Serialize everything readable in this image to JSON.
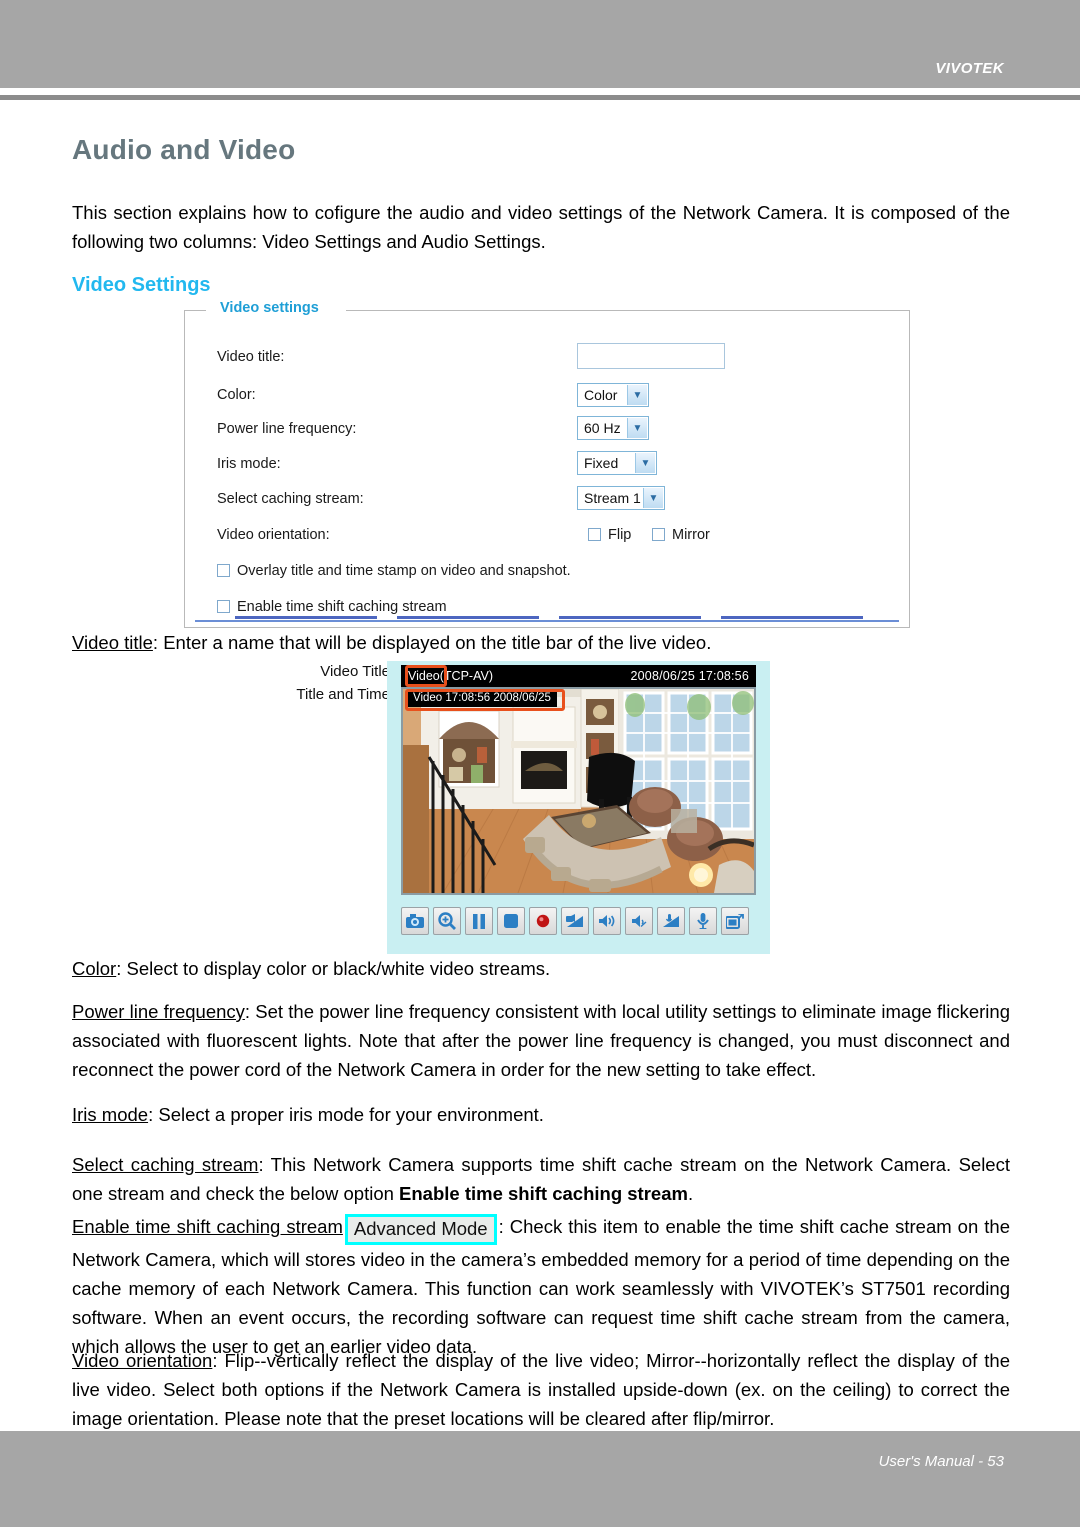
{
  "header": {
    "brand": "VIVOTEK"
  },
  "page": {
    "title": "Audio and Video",
    "intro": "This section explains how to cofigure the audio and video settings of the Network Camera. It is composed of the following two columns: Video Settings and Audio Settings.",
    "section_title": "Video Settings"
  },
  "video_settings_panel": {
    "legend": "Video settings",
    "fields": {
      "video_title_label": "Video title:",
      "video_title_value": "",
      "video_title_placeholder": "",
      "color_label": "Color:",
      "color_value": "Color",
      "power_line_label": "Power line frequency:",
      "power_line_value": "60 Hz",
      "iris_label": "Iris mode:",
      "iris_value": "Fixed",
      "caching_label": "Select caching stream:",
      "caching_value": "Stream 1",
      "orientation_label": "Video orientation:",
      "flip_label": "Flip",
      "mirror_label": "Mirror",
      "overlay_label": "Overlay title and time stamp on video and snapshot.",
      "enable_timeshift_label": "Enable time shift caching stream"
    }
  },
  "camera_illustration": {
    "annotation_video_title": "Video Title",
    "annotation_title_and_time": "Title and Time",
    "titlebar_name": "Video",
    "titlebar_protocol": "(TCP-AV)",
    "titlebar_timestamp": "2008/06/25 17:08:56",
    "osd_text": "Video 17:08:56  2008/06/25",
    "toolbar_icons": [
      "snapshot-icon",
      "digital-zoom-icon",
      "pause-icon",
      "stop-icon",
      "record-icon",
      "volume-level-icon",
      "speaker-icon",
      "speaker-mute-icon",
      "microphone-level-icon",
      "microphone-icon",
      "fullscreen-icon"
    ]
  },
  "paragraphs": {
    "video_title": {
      "term": "Video title",
      "text": ": Enter a name that will be displayed on the title bar of the live video."
    },
    "color": {
      "term": "Color",
      "text": ": Select to display color or black/white video streams."
    },
    "power_line": {
      "term": "Power line frequency",
      "text": ": Set the power line frequency consistent with local utility settings to eliminate image flickering associated with fluorescent lights. Note that after the power line frequency is changed, you must disconnect and reconnect the power cord of the Network Camera in order for the new setting to take effect."
    },
    "iris_mode": {
      "term": "Iris mode",
      "text": ": Select a proper iris mode for your environment."
    },
    "select_caching": {
      "term": "Select caching stream",
      "text_before": ": This Network Camera supports time shift cache stream on the Network Camera. Select one stream and check the below option ",
      "bold": "Enable time shift caching stream",
      "text_after": "."
    },
    "enable_timeshift": {
      "term": "Enable time shift caching stream",
      "badge": "Advanced Mode",
      "text": ": Check this item to enable the time shift cache stream on the Network Camera, which will stores video in the camera’s embedded memory for a period of time depending on the cache memory of each Network Camera. This function can work seamlessly with VIVOTEK’s ST7501 recording software. When an event occurs, the recording software can request time shift cache stream from the camera, which allows the user to get an earlier video data."
    },
    "video_orientation": {
      "term": "Video orientation",
      "text": ": Flip--vertically reflect the display of the live video; Mirror--horizontally reflect the display of the live video. Select both options if the Network Camera is installed upside-down (ex. on the ceiling) to correct the image orientation.  Please note that the preset locations will be cleared after flip/mirror."
    }
  },
  "footer": {
    "text": "User's Manual - 53"
  },
  "colors": {
    "header_gray": "#a6a6a6",
    "title_slate": "#66777e",
    "section_cyan": "#22b8ef",
    "legend_blue": "#1f9fd6",
    "annotation_orange": "#e8501c",
    "badge_cyan": "#00ffff",
    "panel_bg_cyan": "#c9eff2"
  }
}
